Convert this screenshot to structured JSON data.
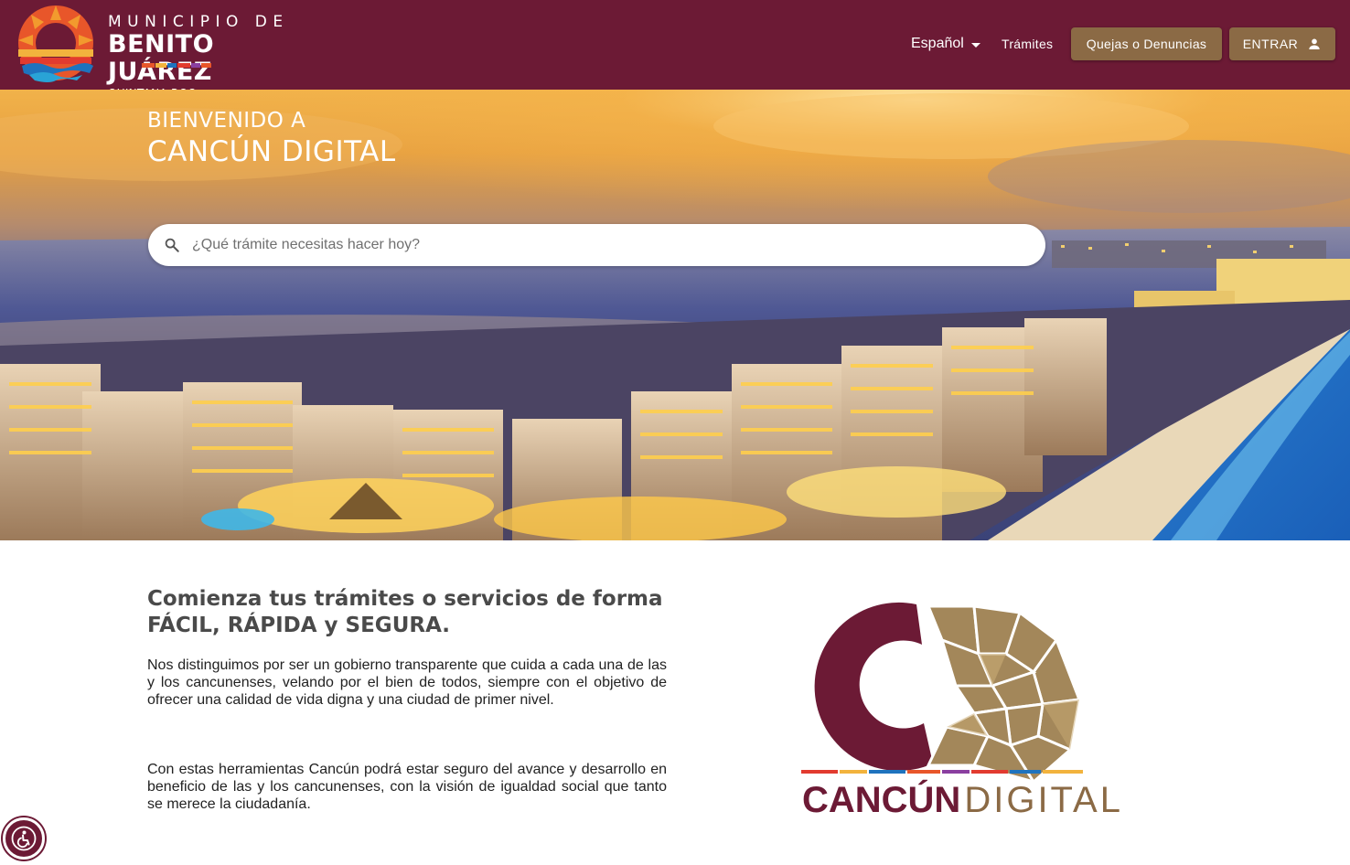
{
  "header": {
    "logo": {
      "line1": "MUNICIPIO DE",
      "line2": "BENITO JUÁREZ",
      "line3": "QUINTANA ROO"
    },
    "language_label": "Español",
    "tramites_label": "Trámites",
    "quejas_label": "Quejas o Denuncias",
    "entrar_label": "ENTRAR"
  },
  "hero": {
    "title_line1": "BIENVENIDO A",
    "title_line2": "CANCÚN DIGITAL",
    "search_placeholder": "¿Qué trámite necesitas hacer hoy?",
    "search_value": ""
  },
  "intro": {
    "heading_line1": "Comienza tus trámites o servicios de forma",
    "heading_line2": "FÁCIL, RÁPIDA y SEGURA.",
    "paragraph1": "Nos distinguimos por ser un gobierno transparente que cuida a cada una de las y los cancunenses, velando por el bien de todos, siempre con el objetivo de ofrecer una calidad de vida digna y una ciudad de primer nivel.",
    "paragraph2": "Con estas herramientas Cancún podrá estar seguro del avance y desarrollo en beneficio de las y los cancunenses, con la visión de igualdad social que tanto se merece la ciudadanía."
  },
  "brand_logo": {
    "word1": "CANCÚN",
    "word2": "DIGITAL"
  },
  "icons": {
    "caret": "caret-down-icon",
    "user": "person-icon",
    "search": "search-icon",
    "accessibility": "accessibility-icon"
  },
  "colors": {
    "header_bg": "#6c1a35",
    "button_bg": "#8b6a45",
    "brand_maroon": "#6c1a35",
    "brand_gold": "#8b6a45"
  }
}
